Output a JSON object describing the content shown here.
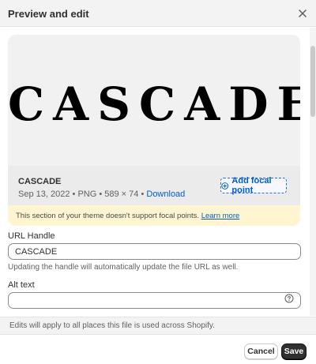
{
  "header": {
    "title": "Preview and edit",
    "close_icon": "close-icon"
  },
  "preview": {
    "image_text": "CASCADE",
    "file_name": "CASCADE",
    "date": "Sep 13, 2022",
    "separator": "•",
    "format": "PNG",
    "dimensions": "589 × 74",
    "download_label": "Download",
    "focal_button_label": "Add focal point",
    "focal_icon": "plus-circle-icon",
    "banner_text": "This section of your theme doesn't support focal points.",
    "banner_link": "Learn more",
    "banner_color": "#fff5d1"
  },
  "fields": {
    "url_handle": {
      "label": "URL Handle",
      "value": "CASCADE",
      "help": "Updating the handle will automatically update the file URL as well."
    },
    "alt_text": {
      "label": "Alt text",
      "value": "",
      "help_icon": "question-circle-icon"
    }
  },
  "note": "Edits will apply to all places this file is used across Shopify.",
  "footer": {
    "cancel_label": "Cancel",
    "save_label": "Save"
  },
  "colors": {
    "link": "#005bd3",
    "primary_button": "#303030"
  }
}
